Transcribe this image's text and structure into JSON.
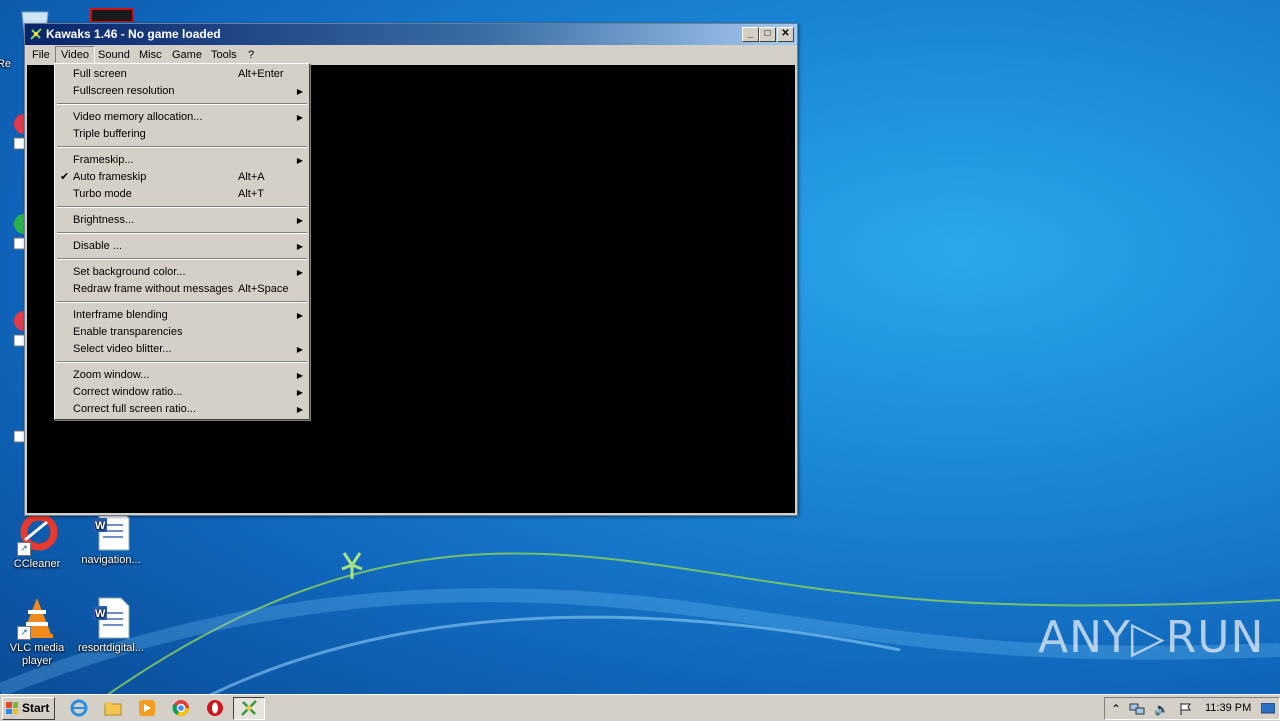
{
  "window": {
    "title": "Kawaks 1.46 - No game loaded",
    "buttons": {
      "minimize": "_",
      "maximize": "□",
      "close": "✕"
    }
  },
  "menubar": {
    "items": [
      "File",
      "Video",
      "Sound",
      "Misc",
      "Game",
      "Tools",
      "?"
    ],
    "active": "Video"
  },
  "video_menu": {
    "items": [
      {
        "label": "Full screen",
        "accel": "Alt+Enter"
      },
      {
        "label": "Fullscreen resolution",
        "submenu": true
      },
      {
        "label": "Video memory allocation...",
        "submenu": true
      },
      {
        "label": "Triple buffering"
      },
      {
        "label": "Frameskip...",
        "submenu": true
      },
      {
        "label": "Auto frameskip",
        "accel": "Alt+A",
        "checked": true
      },
      {
        "label": "Turbo mode",
        "accel": "Alt+T"
      },
      {
        "label": "Brightness...",
        "submenu": true
      },
      {
        "label": "Disable ...",
        "submenu": true
      },
      {
        "label": "Set background color...",
        "submenu": true
      },
      {
        "label": "Redraw frame without messages",
        "accel": "Alt+Space"
      },
      {
        "label": "Interframe blending",
        "submenu": true
      },
      {
        "label": "Enable transparencies"
      },
      {
        "label": "Select video blitter...",
        "submenu": true
      },
      {
        "label": "Zoom window...",
        "submenu": true
      },
      {
        "label": "Correct window ratio...",
        "submenu": true
      },
      {
        "label": "Correct full screen ratio...",
        "submenu": true
      }
    ],
    "check_glyph": "✔",
    "arrow_glyph": "▶"
  },
  "desktop_icons": [
    {
      "label": "CCleaner",
      "icon": "ccleaner-icon"
    },
    {
      "label": "navigation...",
      "icon": "word-document-icon"
    },
    {
      "label": "VLC media player",
      "icon": "vlc-icon"
    },
    {
      "label": "resortdigital...",
      "icon": "word-document-icon"
    }
  ],
  "desktop_partial": {
    "recycle_label": "Re"
  },
  "watermark": {
    "text": "ANY▷RUN"
  },
  "taskbar": {
    "start_label": "Start",
    "quick_launch": [
      "internet-explorer-icon",
      "explorer-icon",
      "media-player-icon",
      "chrome-icon",
      "opera-icon"
    ],
    "active_task": "kawaks-icon",
    "tray": {
      "clock": "11:39 PM",
      "icons": [
        "show-hidden-icon",
        "network-icon",
        "volume-icon",
        "flag-icon",
        "desktop-icon"
      ]
    }
  },
  "colors": {
    "titlebar": "#0a246a",
    "desktop": "#1b86d6",
    "face": "#d4d0c8"
  }
}
